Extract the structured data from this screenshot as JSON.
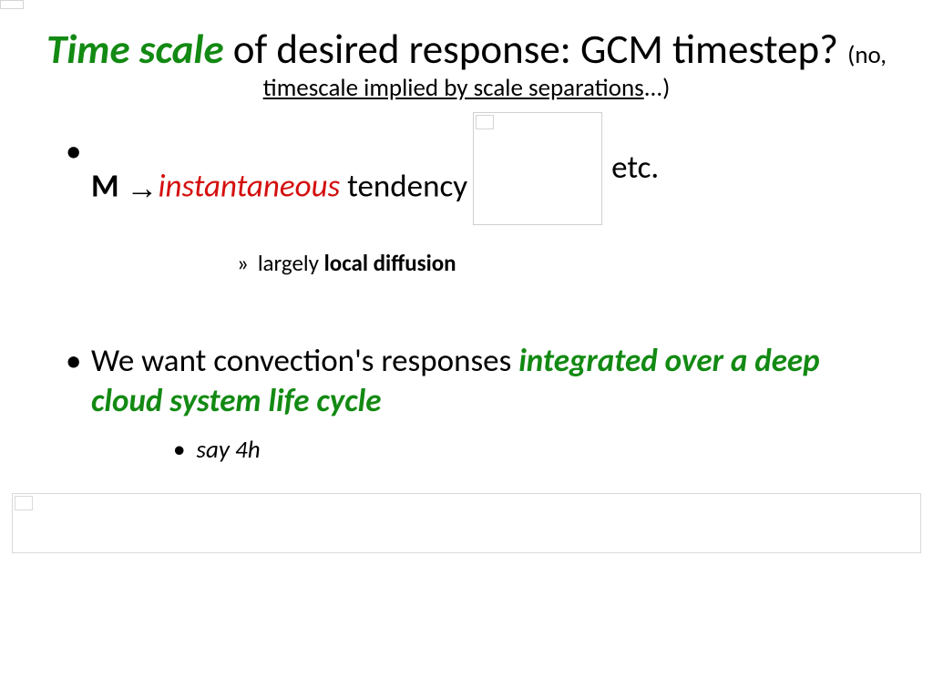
{
  "title": {
    "highlight": "Time scale",
    "rest1": " of desired response: GCM timestep?",
    "annot_no": "(no, ",
    "annot_underline": "timescale implied by scale separations",
    "annot_tail": "...)"
  },
  "bullet1": {
    "m": "M ",
    "arrow": "→",
    "em": "instantaneous",
    "tendency": " tendency",
    "etc": "etc."
  },
  "sub1": {
    "marker": "»",
    "pre": "largely ",
    "bold": "local diffusion"
  },
  "bullet2": {
    "pre": "We want convection's responses ",
    "em": "integrated over a deep cloud system life cycle"
  },
  "sub2": {
    "marker": "•",
    "text": "say 4h"
  }
}
